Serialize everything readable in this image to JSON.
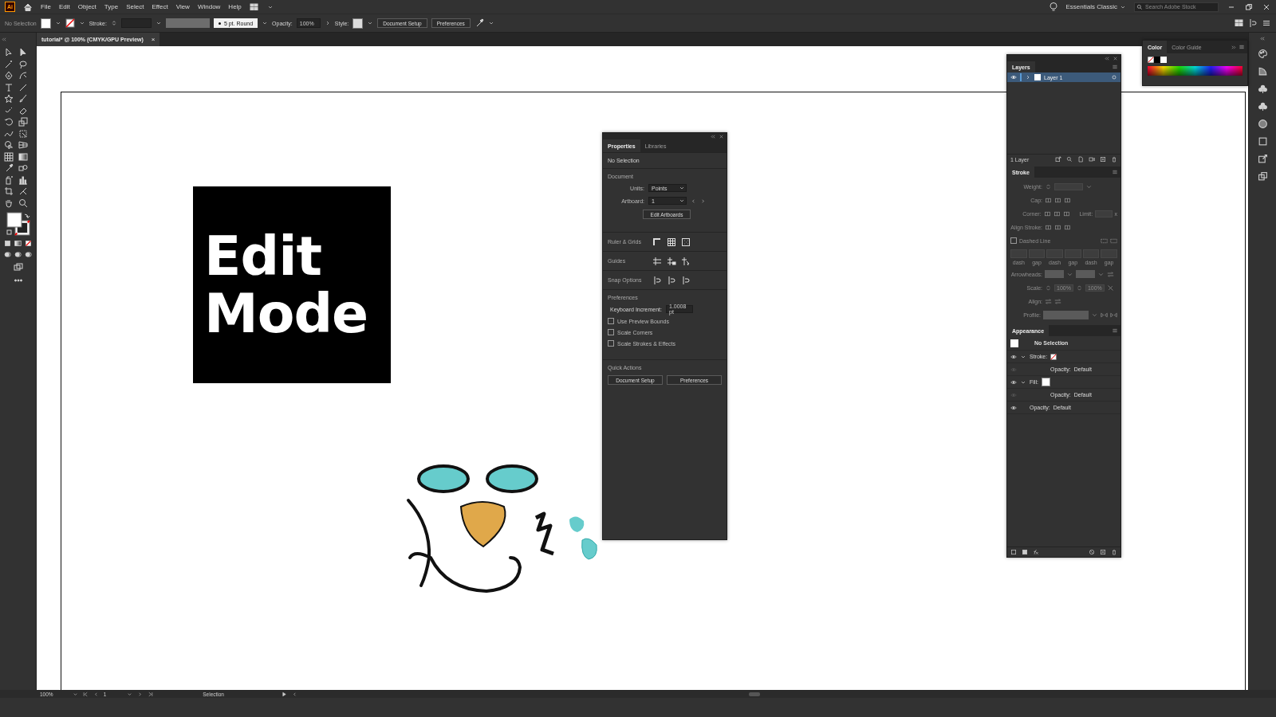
{
  "menu_bar": {
    "app_logo": "Ai",
    "items": [
      "File",
      "Edit",
      "Object",
      "Type",
      "Select",
      "Effect",
      "View",
      "Window",
      "Help"
    ],
    "workspace": "Essentials Classic",
    "search": {
      "placeholder": "Search Adobe Stock"
    }
  },
  "control_bar": {
    "selection": "No Selection",
    "stroke_label": "Stroke:",
    "brush": "5 pt. Round",
    "opacity_label": "Opacity:",
    "opacity": "100%",
    "style_label": "Style:",
    "buttons": [
      "Document Setup",
      "Preferences"
    ]
  },
  "document_tab": {
    "title": "tutorial* @ 100% (CMYK/GPU Preview)",
    "close": "×"
  },
  "artboard": {
    "title_card": [
      "Edit",
      "Mode"
    ]
  },
  "properties_panel": {
    "tabs": [
      {
        "label": "Properties",
        "selected": true
      },
      {
        "label": "Libraries",
        "selected": false
      }
    ],
    "selection": "No Selection",
    "document_heading": "Document",
    "units_label": "Units:",
    "units": "Points",
    "artboard_label": "Artboard:",
    "artboard": "1",
    "edit_button": "Edit Artboards",
    "option_rows": [
      "Ruler & Grids",
      "Guides",
      "Snap Options"
    ],
    "preferences_heading": "Preferences",
    "keyboard_label": "Keyboard Increment:",
    "keyboard_value": "1.0008 pt",
    "checkboxes": [
      {
        "label": "Use Preview Bounds",
        "checked": false
      },
      {
        "label": "Scale Corners",
        "checked": false
      },
      {
        "label": "Scale Strokes & Effects",
        "checked": false
      }
    ],
    "quick_actions_heading": "Quick Actions",
    "buttons": [
      "Document Setup",
      "Preferences"
    ]
  },
  "layers_panel": {
    "title": "Layers",
    "layers": [
      {
        "name": "Layer 1",
        "visible": true,
        "selected": true
      }
    ],
    "count": "1 Layer"
  },
  "stroke_panel": {
    "title": "Stroke",
    "disabled": true,
    "weight_label": "Weight:",
    "cap_label": "Cap:",
    "corner_label": "Corner:",
    "limit_label": "Limit:",
    "limit_unit": "x",
    "align_stroke_label": "Align Stroke:",
    "dashed_line": {
      "label": "Dashed Line",
      "checked": false
    },
    "dash_labels": [
      "dash",
      "gap",
      "dash",
      "gap",
      "dash",
      "gap"
    ],
    "arrowheads_label": "Arrowheads:",
    "scale_label": "Scale:",
    "scale_values": [
      "100%",
      "100%"
    ],
    "align_label": "Align:",
    "profile_label": "Profile:"
  },
  "appearance_panel": {
    "title": "Appearance",
    "header": "No Selection",
    "rows": [
      {
        "kind": "stroke",
        "label": "Stroke:",
        "expanded": true,
        "children": [
          {
            "label": "Opacity:",
            "value": "Default"
          }
        ]
      },
      {
        "kind": "fill",
        "label": "Fill:",
        "expanded": true,
        "children": [
          {
            "label": "Opacity:",
            "value": "Default"
          }
        ]
      },
      {
        "kind": "opacity",
        "label": "Opacity:",
        "value": "Default"
      }
    ]
  },
  "color_panel": {
    "tabs": [
      {
        "label": "Color",
        "selected": true
      },
      {
        "label": "Color Guide",
        "selected": false
      }
    ]
  },
  "status_bar": {
    "zoom": "100%",
    "artboard": "1",
    "tool": "Selection"
  }
}
